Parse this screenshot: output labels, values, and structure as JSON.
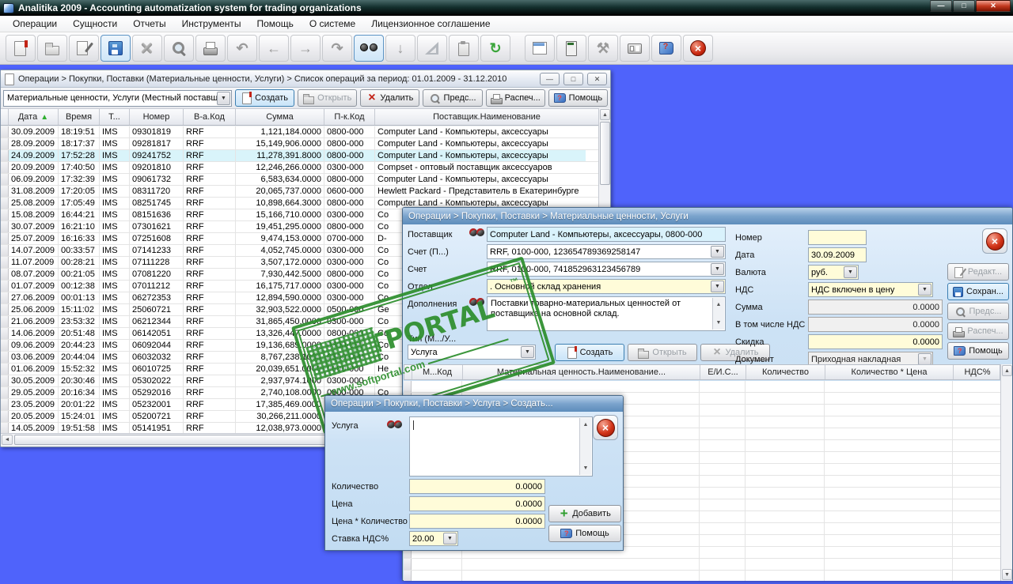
{
  "colors": {
    "desktop": "#4f63fb",
    "accent": "#3c7fb1",
    "input_yellow": "#fffcd9",
    "input_blue": "#d9f2fc",
    "selected_row": "#d9f4fa",
    "stamp_green": "#2e8f2e"
  },
  "app": {
    "title": "Analitika 2009 - Accounting automatization system for trading organizations",
    "window_controls": {
      "minimize": "—",
      "restore": "□",
      "close": "✕"
    },
    "menu": [
      "Операции",
      "Сущности",
      "Отчеты",
      "Инструменты",
      "Помощь",
      "О системе",
      "Лицензионное соглашение"
    ]
  },
  "toolbar": {
    "buttons": [
      {
        "name": "new",
        "icon": "ic-page-new",
        "active": false,
        "gap": false
      },
      {
        "name": "open",
        "icon": "ic-folder",
        "active": false,
        "gap": false
      },
      {
        "name": "edit",
        "icon": "ic-edit",
        "active": false,
        "gap": false
      },
      {
        "name": "save",
        "icon": "ic-floppy",
        "active": true,
        "gap": false
      },
      {
        "name": "delete",
        "icon": "ic-xgrey",
        "active": false,
        "gap": false
      },
      {
        "name": "search",
        "icon": "ic-mag",
        "active": false,
        "gap": false
      },
      {
        "name": "print",
        "icon": "ic-printer",
        "active": false,
        "gap": false
      },
      {
        "name": "undo",
        "icon": "glyph",
        "glyph": "↶",
        "active": false,
        "gap": false
      },
      {
        "name": "back",
        "icon": "glyph",
        "glyph": "←",
        "active": false,
        "gap": false
      },
      {
        "name": "forward",
        "icon": "glyph",
        "glyph": "→",
        "active": false,
        "gap": false
      },
      {
        "name": "redo",
        "icon": "glyph",
        "glyph": "↷",
        "active": false,
        "gap": false
      },
      {
        "name": "find",
        "icon": "ic-binoc",
        "active": true,
        "gap": false
      },
      {
        "name": "download",
        "icon": "glyph",
        "glyph": "↓",
        "active": false,
        "gap": false
      },
      {
        "name": "ruler",
        "icon": "ic-ruler",
        "active": false,
        "gap": false
      },
      {
        "name": "paste",
        "icon": "ic-paste",
        "active": false,
        "gap": false
      },
      {
        "name": "refresh",
        "icon": "glyph",
        "glyph": "↻",
        "active": false,
        "gap": false,
        "green": true
      },
      {
        "name": "calendar",
        "icon": "ic-calendar",
        "active": false,
        "gap": true
      },
      {
        "name": "calculator",
        "icon": "ic-calc",
        "active": false,
        "gap": false
      },
      {
        "name": "tools",
        "icon": "glyph",
        "glyph": "⚒",
        "active": false,
        "gap": false
      },
      {
        "name": "card-file",
        "icon": "ic-cards",
        "active": false,
        "gap": false
      },
      {
        "name": "help",
        "icon": "ic-book",
        "active": false,
        "gap": false
      },
      {
        "name": "exit",
        "icon": "ic-exit",
        "active": false,
        "gap": false
      }
    ]
  },
  "main_window": {
    "title": "Операции > Покупки, Поставки (Материальные ценности, Услуги) > Список операций за период: 01.01.2009 - 31.12.2010",
    "controls": {
      "minimize": "—",
      "maximize": "□",
      "close": "✕"
    },
    "filter_combo": "Материальные ценности, Услуги (Местный поставщ",
    "buttons": {
      "create": "Создать",
      "open": "Открыть",
      "delete": "Удалить",
      "preview": "Предс...",
      "print": "Распеч...",
      "help": "Помощь"
    },
    "table": {
      "columns": [
        "Дата",
        "Время",
        "Т...",
        "Номер",
        "В-а.Код",
        "Сумма",
        "П-к.Код",
        "Поставщик.Наименование"
      ],
      "selected_row_index": 2,
      "rows": [
        [
          "30.09.2009",
          "18:19:51",
          "IMS",
          "09301819",
          "RRF",
          "1,121,184.0000",
          "0800-000",
          "Computer Land - Компьютеры, аксессуары"
        ],
        [
          "28.09.2009",
          "18:17:37",
          "IMS",
          "09281817",
          "RRF",
          "15,149,906.0000",
          "0800-000",
          "Computer Land - Компьютеры, аксессуары"
        ],
        [
          "24.09.2009",
          "17:52:28",
          "IMS",
          "09241752",
          "RRF",
          "11,278,391.8000",
          "0800-000",
          "Computer Land - Компьютеры, аксессуары"
        ],
        [
          "20.09.2009",
          "17:40:50",
          "IMS",
          "09201810",
          "RRF",
          "12,246,266.0000",
          "0300-000",
          "Compset - оптовый поставщик аксессуаров"
        ],
        [
          "06.09.2009",
          "17:32:39",
          "IMS",
          "09061732",
          "RRF",
          "6,583,634.0000",
          "0800-000",
          "Computer Land - Компьютеры, аксессуары"
        ],
        [
          "31.08.2009",
          "17:20:05",
          "IMS",
          "08311720",
          "RRF",
          "20,065,737.0000",
          "0600-000",
          "Hewlett Packard - Представитель в Екатеринбурге"
        ],
        [
          "25.08.2009",
          "17:05:49",
          "IMS",
          "08251745",
          "RRF",
          "10,898,664.3000",
          "0800-000",
          "Computer Land - Компьютеры, аксессуары"
        ],
        [
          "15.08.2009",
          "16:44:21",
          "IMS",
          "08151636",
          "RRF",
          "15,166,710.0000",
          "0300-000",
          "Co"
        ],
        [
          "30.07.2009",
          "16:21:10",
          "IMS",
          "07301621",
          "RRF",
          "19,451,295.0000",
          "0800-000",
          "Co"
        ],
        [
          "25.07.2009",
          "16:16:33",
          "IMS",
          "07251608",
          "RRF",
          "9,474,153.0000",
          "0700-000",
          "D-"
        ],
        [
          "14.07.2009",
          "00:33:57",
          "IMS",
          "07141233",
          "RRF",
          "4,052,745.0000",
          "0300-000",
          "Co"
        ],
        [
          "11.07.2009",
          "00:28:21",
          "IMS",
          "07111228",
          "RRF",
          "3,507,172.0000",
          "0300-000",
          "Co"
        ],
        [
          "08.07.2009",
          "00:21:05",
          "IMS",
          "07081220",
          "RRF",
          "7,930,442.5000",
          "0800-000",
          "Co"
        ],
        [
          "01.07.2009",
          "00:12:38",
          "IMS",
          "07011212",
          "RRF",
          "16,175,717.0000",
          "0300-000",
          "Co"
        ],
        [
          "27.06.2009",
          "00:01:13",
          "IMS",
          "06272353",
          "RRF",
          "12,894,590.0000",
          "0300-000",
          "Co"
        ],
        [
          "25.06.2009",
          "15:11:02",
          "IMS",
          "25060721",
          "RRF",
          "32,903,522.0000",
          "0500-000",
          "Ge"
        ],
        [
          "21.06.2009",
          "23:53:32",
          "IMS",
          "06212344",
          "RRF",
          "31,865,450.0000",
          "0300-000",
          "Co"
        ],
        [
          "14.06.2009",
          "20:51:48",
          "IMS",
          "06142051",
          "RRF",
          "13,326,447.0000",
          "0800-000",
          "Co"
        ],
        [
          "09.06.2009",
          "20:44:23",
          "IMS",
          "06092044",
          "RRF",
          "19,136,689.0000",
          "0300-000",
          "Co"
        ],
        [
          "03.06.2009",
          "20:44:04",
          "IMS",
          "06032032",
          "RRF",
          "8,767,238.1000",
          "0300-000",
          "Co"
        ],
        [
          "01.06.2009",
          "15:52:32",
          "IMS",
          "06010725",
          "RRF",
          "20,039,651.0000",
          "0600-000",
          "He"
        ],
        [
          "30.05.2009",
          "20:30:46",
          "IMS",
          "05302022",
          "RRF",
          "2,937,974.1000",
          "0300-000",
          ""
        ],
        [
          "29.05.2009",
          "20:16:34",
          "IMS",
          "05292016",
          "RRF",
          "2,740,108.0000",
          "0800-000",
          "Co"
        ],
        [
          "23.05.2009",
          "20:01:22",
          "IMS",
          "05232001",
          "RRF",
          "17,385,469.0000",
          "",
          ""
        ],
        [
          "20.05.2009",
          "15:24:01",
          "IMS",
          "05200721",
          "RRF",
          "30,266,211.0000",
          "",
          ""
        ],
        [
          "14.05.2009",
          "19:51:58",
          "IMS",
          "05141951",
          "RRF",
          "12,038,973.0000",
          "",
          ""
        ]
      ]
    }
  },
  "dialog_operation": {
    "title": "Операции > Покупки, Поставки > Материальные ценности, Услуги",
    "labels": {
      "supplier": "Поставщик",
      "account_p": "Счет (П...)",
      "account": "Счет",
      "department": "Отдел",
      "additions": "Дополнения",
      "type": "Тип (М.../У...",
      "number": "Номер",
      "date": "Дата",
      "currency": "Валюта",
      "vat": "НДС",
      "sum": "Сумма",
      "vat_included": "В том числе НДС",
      "discount": "Скидка",
      "document": "Документ"
    },
    "fields": {
      "supplier": "Computer Land - Компьютеры, аксессуары, 0800-000",
      "account_p": "RRF, 0100-000, 123654789369258147",
      "account": "RRF, 0100-000, 741852963123456789",
      "department": ". Основной склад хранения",
      "additions": "Поставки товарно-материальных ценностей от поставщика на основной склад.",
      "type_combo": "Услуга",
      "number": "",
      "date": "30.09.2009",
      "currency": "руб.",
      "vat": "НДС включен в цену",
      "sum": "0.0000",
      "vat_included": "0.0000",
      "discount": "0.0000",
      "document": "Приходная накладная"
    },
    "buttons": {
      "create": "Создать",
      "open": "Открыть",
      "delete": "Удалить",
      "edit": "Редакт...",
      "save": "Сохран...",
      "preview": "Предс...",
      "print": "Распеч...",
      "help": "Помощь"
    },
    "items_table": {
      "columns": [
        "М...Код",
        "Материальная ценность.Наименование...",
        "Е/И.С...",
        "Количество",
        "Количество * Цена",
        "НДС%"
      ],
      "rows": []
    }
  },
  "dialog_service": {
    "title": "Операции > Покупки, Поставки > Услуга > Создать...",
    "labels": {
      "service": "Услуга",
      "quantity": "Количество",
      "price": "Цена",
      "price_qty": "Цена * Количество",
      "vat_rate": "Ставка НДС%"
    },
    "fields": {
      "service": "",
      "quantity": "0.0000",
      "price": "0.0000",
      "price_qty": "0.0000",
      "vat_rate": "20.00"
    },
    "buttons": {
      "add": "Добавить",
      "help": "Помощь"
    }
  },
  "watermark": {
    "name": "SOFTPORTAL",
    "tm": "™",
    "url": "www.softportal.com"
  }
}
